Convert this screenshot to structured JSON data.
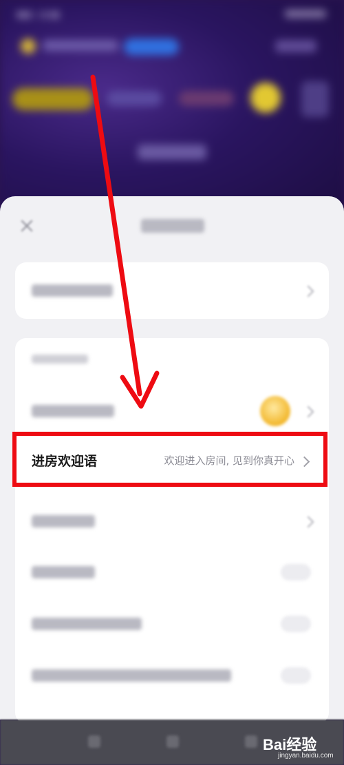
{
  "highlighted_row": {
    "label": "进房欢迎语",
    "value": "欢迎进入房间, 见到你真开心"
  },
  "watermark": {
    "text": "Bai经验",
    "sub": "jingyan.baidu.com"
  },
  "colors": {
    "highlight_border": "#ee0b12",
    "arrow": "#ee0b12",
    "sheet_bg": "#f1f1f4",
    "background_app": "#2a1450"
  },
  "icons": [
    "close-icon",
    "chevron-right-icon",
    "avatar",
    "toggle-switch",
    "down-arrow-annotation",
    "baidu-paw-logo"
  ]
}
